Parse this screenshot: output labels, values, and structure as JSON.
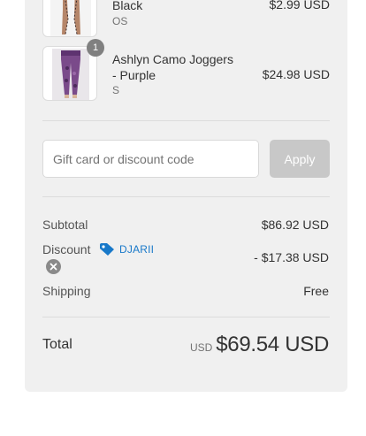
{
  "items": [
    {
      "name": "Black",
      "variant": "OS",
      "price": "$2.99 USD",
      "image": "leggings-product-image"
    },
    {
      "name_line1": "Ashlyn Camo Joggers",
      "name_line2": "- Purple",
      "variant": "S",
      "price": "$24.98 USD",
      "quantity": "1",
      "image": "purple-joggers-product-image"
    }
  ],
  "discount": {
    "placeholder": "Gift card or discount code",
    "apply_label": "Apply"
  },
  "summary": {
    "subtotal_label": "Subtotal",
    "subtotal_value": "$86.92 USD",
    "discount_label": "Discount",
    "discount_code": "DJARII",
    "discount_value": "- $17.38 USD",
    "shipping_label": "Shipping",
    "shipping_value": "Free"
  },
  "total": {
    "label": "Total",
    "currency": "USD",
    "value": "$69.54 USD"
  },
  "colors": {
    "panel_bg": "#f0f0f0",
    "accent": "#1979c9",
    "apply_disabled": "#c8c8c8",
    "badge": "#808080"
  }
}
